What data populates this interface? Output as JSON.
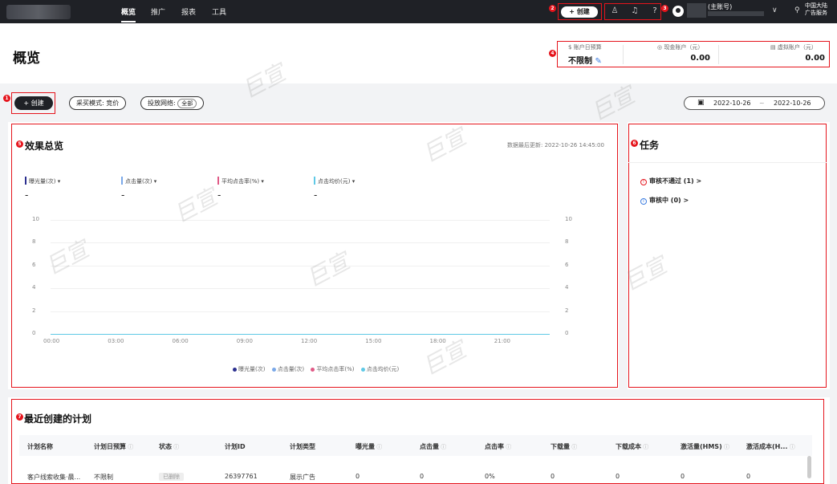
{
  "nav": {
    "items": [
      "概览",
      "推广",
      "报表",
      "工具"
    ],
    "create_label": "+ 创建",
    "account_role": "(主账号)",
    "region_line1": "中国大陆",
    "region_line2": "广告服务"
  },
  "header": {
    "title": "概览",
    "accounts": [
      {
        "label": "账户日预算",
        "value": "不限制"
      },
      {
        "label": "现金账户（元）",
        "value": "0.00"
      },
      {
        "label": "虚拟账户（元）",
        "value": "0.00"
      }
    ]
  },
  "filters": {
    "create_label": "+ 创建",
    "buy_mode": "采买模式: 竞价",
    "network_label": "投放网络:",
    "network_value": "全部",
    "date_start": "2022-10-26",
    "date_sep": "~",
    "date_end": "2022-10-26"
  },
  "markers": [
    "1",
    "2",
    "3",
    "4",
    "5",
    "6",
    "7"
  ],
  "overview": {
    "title": "效果总览",
    "updated": "数据最后更新: 2022-10-26 14:45:00",
    "metrics": [
      {
        "label": "曝光量(次)",
        "value": "-",
        "color": "#2b2f8f"
      },
      {
        "label": "点击量(次)",
        "value": "-",
        "color": "#7aa8e8"
      },
      {
        "label": "平均点击率(%)",
        "value": "-",
        "color": "#e05a86"
      },
      {
        "label": "点击均价(元)",
        "value": "-",
        "color": "#5fc9e6"
      }
    ],
    "legend": [
      {
        "label": "曝光量(次)",
        "color": "#2b2f8f"
      },
      {
        "label": "点击量(次)",
        "color": "#7aa8e8"
      },
      {
        "label": "平均点击率(%)",
        "color": "#e05a86"
      },
      {
        "label": "点击均价(元)",
        "color": "#5fc9e6"
      }
    ]
  },
  "chart_data": {
    "type": "line",
    "x": [
      "00:00",
      "03:00",
      "06:00",
      "09:00",
      "12:00",
      "15:00",
      "18:00",
      "21:00"
    ],
    "y_ticks": [
      "0",
      "2",
      "4",
      "6",
      "8",
      "10"
    ],
    "ylim": [
      0,
      10
    ],
    "series": [
      {
        "name": "曝光量(次)",
        "values": [
          0,
          0,
          0,
          0,
          0,
          0,
          0,
          0
        ]
      },
      {
        "name": "点击量(次)",
        "values": [
          0,
          0,
          0,
          0,
          0,
          0,
          0,
          0
        ]
      },
      {
        "name": "平均点击率(%)",
        "values": [
          0,
          0,
          0,
          0,
          0,
          0,
          0,
          0
        ]
      },
      {
        "name": "点击均价(元)",
        "values": [
          0,
          0,
          0,
          0,
          0,
          0,
          0,
          0
        ]
      }
    ],
    "grid": true,
    "legend_position": "bottom"
  },
  "tasks": {
    "title": "任务",
    "items": [
      {
        "label": "审核不通过 (1) >",
        "color": "#e5141c"
      },
      {
        "label": "审核中 (0) >",
        "color": "#3a7be0"
      }
    ]
  },
  "plans": {
    "title": "最近创建的计划",
    "columns": [
      "计划名称",
      "计划日预算",
      "状态",
      "计划ID",
      "计划类型",
      "曝光量",
      "点击量",
      "点击率",
      "下载量",
      "下载成本",
      "激活量(HMS)",
      "激活成本(H..."
    ],
    "row": [
      "客户线索收集·晨...",
      "不限制",
      "已删除",
      "26397761",
      "展示广告",
      "0",
      "0",
      "0%",
      "0",
      "0",
      "0",
      "0"
    ]
  },
  "watermark_text": "巨宣"
}
